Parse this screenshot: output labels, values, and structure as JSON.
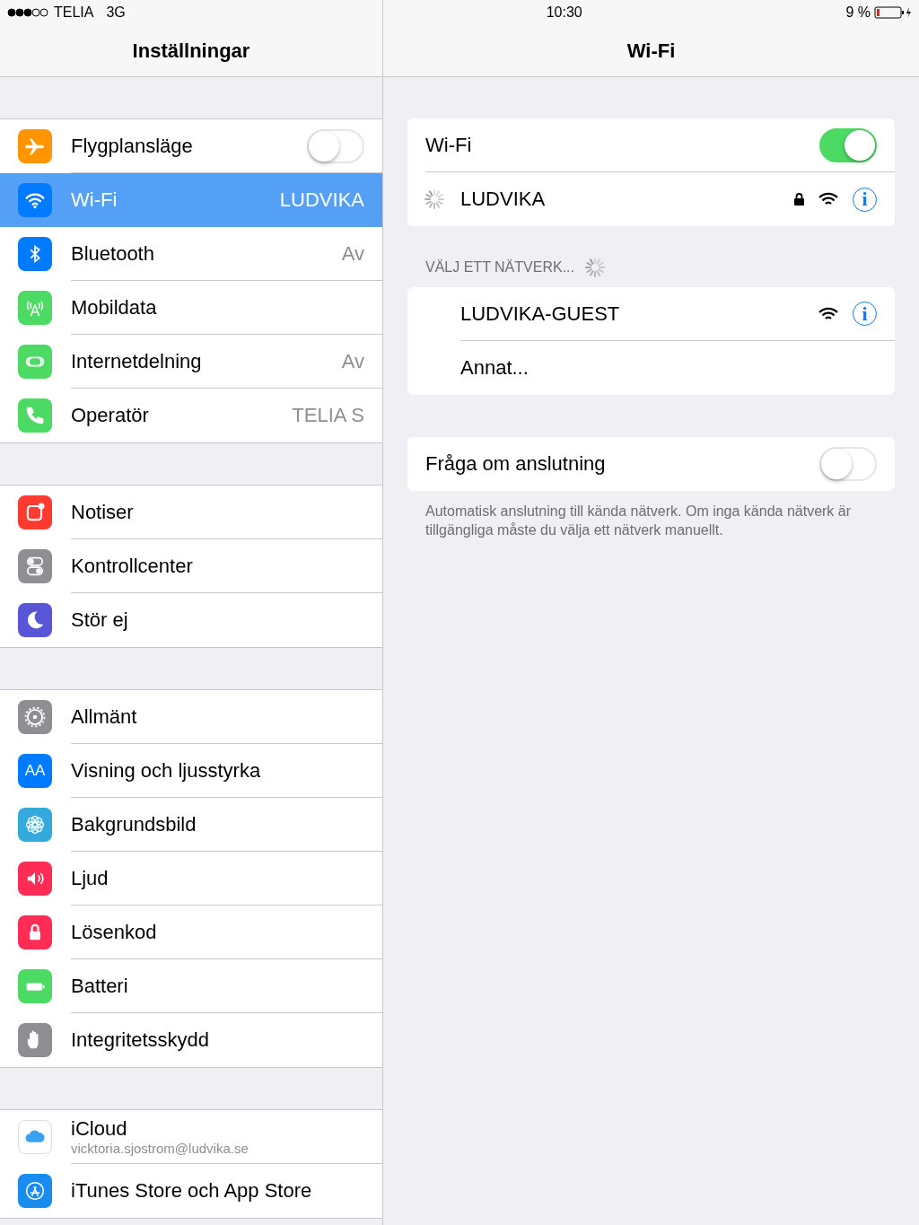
{
  "status_bar": {
    "carrier": "TELIA",
    "network": "3G",
    "time": "10:30",
    "battery": "9 %"
  },
  "sidebar": {
    "title": "Inställningar",
    "groups": [
      [
        {
          "label": "Flygplansläge",
          "kind": "toggle",
          "on": false,
          "selected": false
        },
        {
          "label": "Wi-Fi",
          "kind": "value",
          "value": "LUDVIKA",
          "selected": true
        },
        {
          "label": "Bluetooth",
          "kind": "value",
          "value": "Av",
          "selected": false
        },
        {
          "label": "Mobildata",
          "kind": "plain",
          "selected": false
        },
        {
          "label": "Internetdelning",
          "kind": "value",
          "value": "Av",
          "selected": false
        },
        {
          "label": "Operatör",
          "kind": "value",
          "value": "TELIA S",
          "selected": false
        }
      ],
      [
        {
          "label": "Notiser",
          "kind": "plain",
          "selected": false
        },
        {
          "label": "Kontrollcenter",
          "kind": "plain",
          "selected": false
        },
        {
          "label": "Stör ej",
          "kind": "plain",
          "selected": false
        }
      ],
      [
        {
          "label": "Allmänt",
          "kind": "plain",
          "selected": false
        },
        {
          "label": "Visning och ljusstyrka",
          "kind": "plain",
          "selected": false,
          "icon_text": "AA"
        },
        {
          "label": "Bakgrundsbild",
          "kind": "plain",
          "selected": false
        },
        {
          "label": "Ljud",
          "kind": "plain",
          "selected": false
        },
        {
          "label": "Lösenkod",
          "kind": "plain",
          "selected": false
        },
        {
          "label": "Batteri",
          "kind": "plain",
          "selected": false
        },
        {
          "label": "Integritetsskydd",
          "kind": "plain",
          "selected": false
        }
      ],
      [
        {
          "label": "iCloud",
          "kind": "subtitle",
          "subtitle": "vicktoria.sjostrom@ludvika.se",
          "selected": false
        },
        {
          "label": "iTunes Store och App Store",
          "kind": "plain",
          "selected": false
        }
      ]
    ]
  },
  "detail": {
    "title": "Wi-Fi",
    "wifi": {
      "label": "Wi-Fi",
      "on": true
    },
    "current_network": {
      "name": "LUDVIKA",
      "connecting": true,
      "locked": true,
      "info": "i"
    },
    "section_header": {
      "label": "VÄLJ ETT NÄTVERK...",
      "scanning": true
    },
    "networks": [
      {
        "kind": "network",
        "name": "LUDVIKA-GUEST",
        "locked": false,
        "info": "i"
      },
      {
        "kind": "other",
        "name": "Annat..."
      }
    ],
    "ask_to_join": {
      "label": "Fråga om anslutning",
      "on": false
    },
    "footer": "Automatisk anslutning till kända nätverk. Om inga kända nätverk är tillgängliga måste du välja ett nätverk manuellt."
  }
}
